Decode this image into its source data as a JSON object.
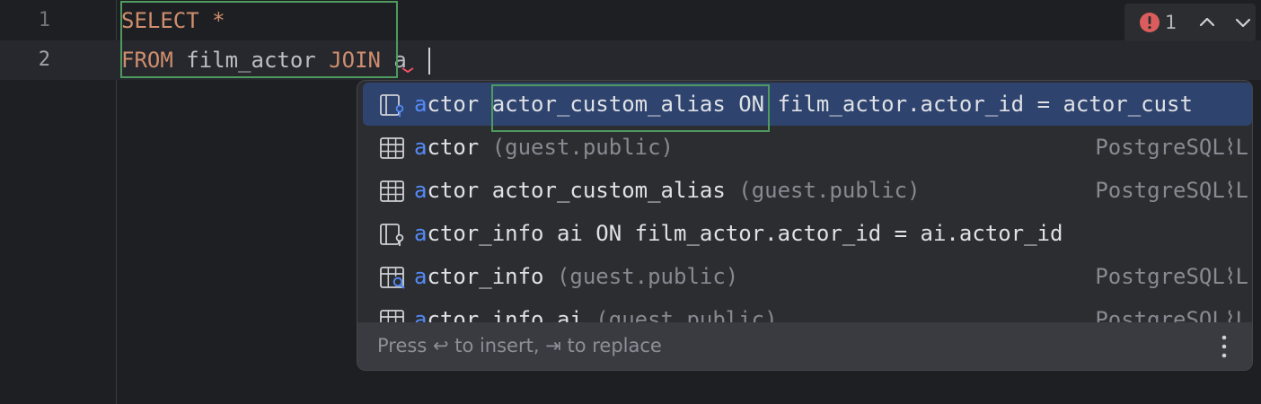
{
  "editor": {
    "lines": [
      {
        "number": "1",
        "tokens": [
          {
            "text": "SELECT",
            "kind": "keyword"
          },
          {
            "text": " *",
            "kind": "keyword"
          }
        ]
      },
      {
        "number": "2",
        "tokens": [
          {
            "text": "FROM",
            "kind": "keyword"
          },
          {
            "text": " film_actor ",
            "kind": "plain"
          },
          {
            "text": "JOIN",
            "kind": "keyword"
          },
          {
            "text": " a",
            "kind": "plain"
          }
        ]
      }
    ]
  },
  "inspection_widget": {
    "error_count": "1",
    "error_icon": "error-icon",
    "prev_icon": "chevron-up-icon",
    "next_icon": "chevron-down-icon"
  },
  "completion_popup": {
    "items": [
      {
        "icon": "join-clause-icon",
        "match": "a",
        "rest": "ctor",
        "detail": " actor_custom_alias ON film_actor.actor_id = actor_cust",
        "source": ""
      },
      {
        "icon": "table-icon",
        "match": "a",
        "rest": "ctor",
        "detail": " (guest.public)",
        "source": "PostgreSQL⌇L"
      },
      {
        "icon": "table-icon",
        "match": "a",
        "rest": "ctor actor_custom_alias",
        "detail": " (guest.public)",
        "source": "PostgreSQL⌇L"
      },
      {
        "icon": "join-clause-icon",
        "match": "a",
        "rest": "ctor_info ai ON film_actor.actor_id = ai.actor_id",
        "detail": "",
        "source": ""
      },
      {
        "icon": "view-icon",
        "match": "a",
        "rest": "ctor_info",
        "detail": " (guest.public)",
        "source": "PostgreSQL⌇L"
      },
      {
        "icon": "table-icon",
        "match": "a",
        "rest": "ctor_info ai",
        "detail": " (guest.public)",
        "source": "PostgreSQL⌇L"
      }
    ],
    "footer_hint": "Press ↩ to insert, ⇥ to replace",
    "menu_icon": "more-vertical-icon"
  },
  "colors": {
    "background": "#1e1f22",
    "keyword": "#cf8e6d",
    "match_highlight": "#548af7",
    "selection": "#2e436e",
    "annotation_box": "#4e9a5f"
  }
}
